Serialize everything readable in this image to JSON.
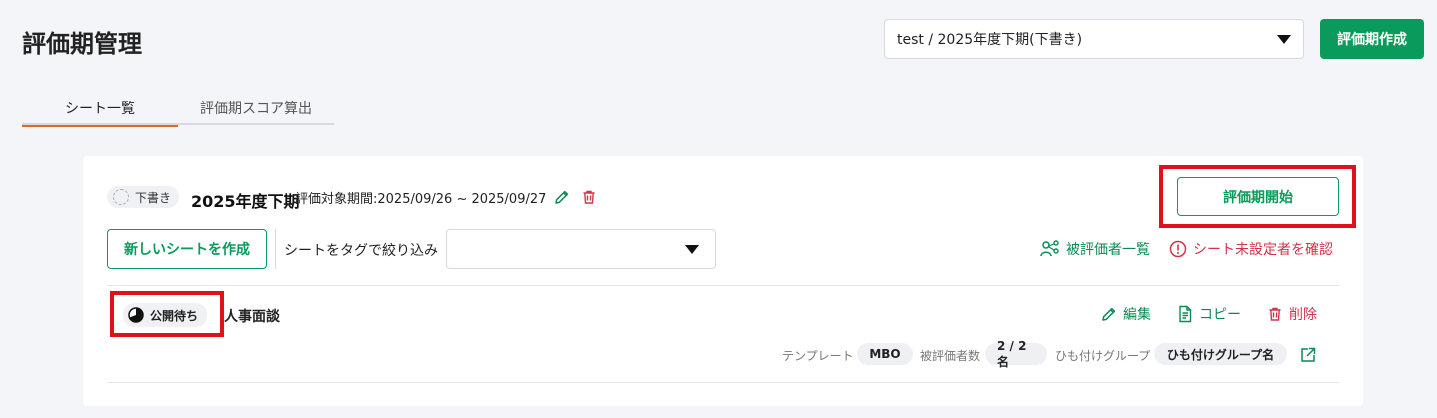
{
  "header": {
    "title": "評価期管理",
    "period_select_value": "test / 2025年度下期(下書き)",
    "create_period_label": "評価期作成"
  },
  "tabs": [
    {
      "label": "シート一覧",
      "active": true
    },
    {
      "label": "評価期スコア算出",
      "active": false
    }
  ],
  "period": {
    "status": "下書き",
    "name": "2025年度下期",
    "range_label": "評価対象期間:2025/09/26 ~ 2025/09/27",
    "start_button_label": "評価期開始"
  },
  "toolbar": {
    "new_sheet_label": "新しいシートを作成",
    "tag_filter_label": "シートをタグで絞り込み",
    "tag_filter_value": "",
    "evaluee_list_label": "被評価者一覧",
    "unset_check_label": "シート未設定者を確認"
  },
  "sheets": [
    {
      "status": "公開待ち",
      "name": "人事面談",
      "actions": {
        "edit": "編集",
        "copy": "コピー",
        "delete": "削除"
      },
      "meta": {
        "template_label": "テンプレート",
        "template_value": "MBO",
        "evaluee_count_label": "被評価者数",
        "evaluee_count_value": "2 / 2名",
        "group_label": "ひも付けグループ",
        "group_value": "ひも付けグループ名"
      }
    }
  ],
  "colors": {
    "primary": "#0a9a5c",
    "danger": "#d0344a",
    "tab_accent": "#e06a1f",
    "highlight": "#e0111b"
  }
}
